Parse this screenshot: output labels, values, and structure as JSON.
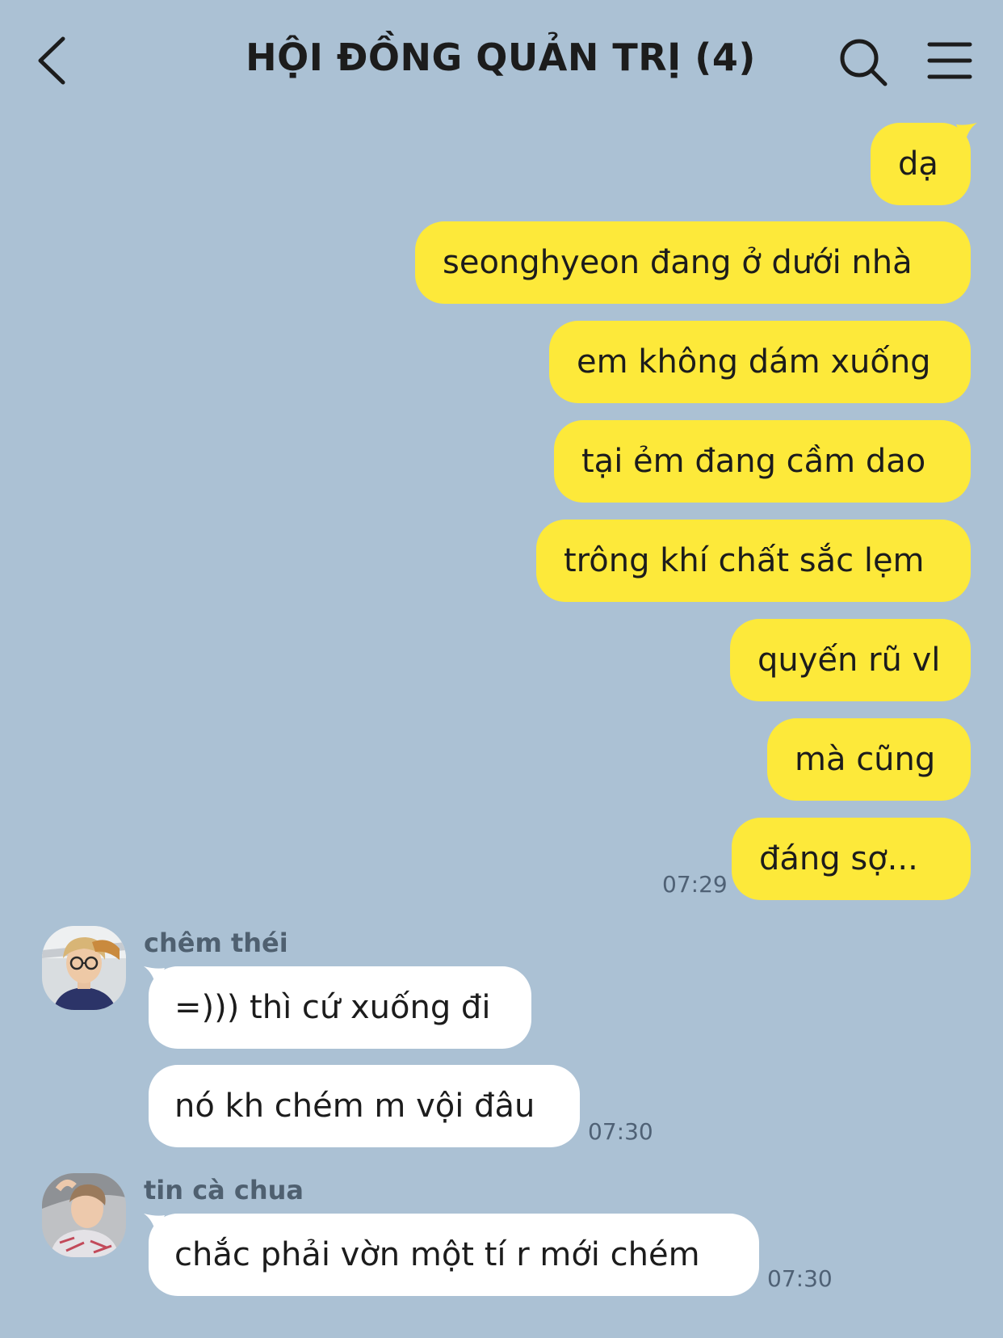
{
  "header": {
    "title": "HỘI ĐỒNG QUẢN TRỊ (4)",
    "back_icon": "chevron-left-icon",
    "search_icon": "search-icon",
    "menu_icon": "menu-icon"
  },
  "colors": {
    "background": "#abc1d4",
    "outgoing_bubble": "#fde93a",
    "incoming_bubble": "#ffffff"
  },
  "outgoing": {
    "messages": [
      "dạ",
      "seonghyeon đang ở dưới nhà",
      "em không dám xuống",
      "tại ẻm đang cầm dao",
      "trông khí chất sắc lẹm",
      "quyến rũ vl",
      "mà cũng",
      "đáng sợ..."
    ],
    "time": "07:29"
  },
  "group1": {
    "sender": "chêm théi",
    "messages": [
      "=))) thì cứ xuống đi",
      "nó kh chém m vội đâu"
    ],
    "time": "07:30"
  },
  "group2": {
    "sender": "tin cà chua",
    "messages": [
      "chắc phải vờn một tí r mới chém"
    ],
    "time": "07:30"
  }
}
